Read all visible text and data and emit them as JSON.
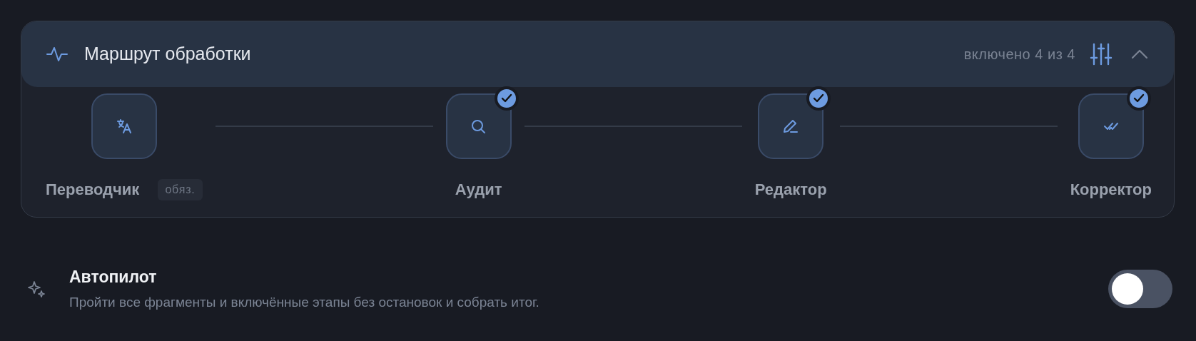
{
  "route": {
    "title": "Маршрут обработки",
    "enabled_count": "включено 4 из 4",
    "expanded": true,
    "stages": [
      {
        "label": "Переводчик",
        "checked": false,
        "badge": "обяз."
      },
      {
        "label": "Аудит",
        "checked": true
      },
      {
        "label": "Редактор",
        "checked": true
      },
      {
        "label": "Корректор",
        "checked": true
      }
    ]
  },
  "autopilot": {
    "title": "Автопилот",
    "description": "Пройти все фрагменты и включённые этапы без остановок и собрать итог.",
    "on": false
  }
}
